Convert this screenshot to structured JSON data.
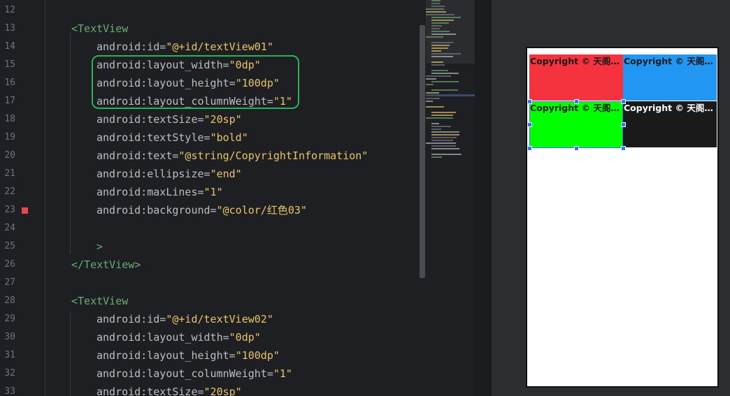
{
  "editor": {
    "line_numbers": [
      "12",
      "13",
      "14",
      "15",
      "16",
      "17",
      "18",
      "19",
      "20",
      "21",
      "22",
      "23",
      "24",
      "25",
      "26",
      "27",
      "28",
      "29",
      "30",
      "31",
      "32",
      "33"
    ],
    "lines": [
      {
        "indent": 0,
        "parts": []
      },
      {
        "indent": 1,
        "parts": [
          {
            "t": "tag",
            "v": "<TextView"
          }
        ]
      },
      {
        "indent": 2,
        "parts": [
          {
            "t": "attr",
            "v": "android:id="
          },
          {
            "t": "val",
            "v": "\"@+id/textView01\""
          }
        ]
      },
      {
        "indent": 2,
        "parts": [
          {
            "t": "attr",
            "v": "android:layout_width="
          },
          {
            "t": "val",
            "v": "\"0dp\""
          }
        ]
      },
      {
        "indent": 2,
        "parts": [
          {
            "t": "attr",
            "v": "android:layout_height="
          },
          {
            "t": "val",
            "v": "\"100dp\""
          }
        ]
      },
      {
        "indent": 2,
        "parts": [
          {
            "t": "attr",
            "v": "android:layout_columnWeight="
          },
          {
            "t": "val",
            "v": "\"1\""
          }
        ]
      },
      {
        "indent": 2,
        "parts": [
          {
            "t": "attr",
            "v": "android:textSize="
          },
          {
            "t": "val",
            "v": "\"20sp\""
          }
        ]
      },
      {
        "indent": 2,
        "parts": [
          {
            "t": "attr",
            "v": "android:textStyle="
          },
          {
            "t": "val",
            "v": "\"bold\""
          }
        ]
      },
      {
        "indent": 2,
        "parts": [
          {
            "t": "attr",
            "v": "android:text="
          },
          {
            "t": "val",
            "v": "\"@string/CopyrightInformation\""
          }
        ]
      },
      {
        "indent": 2,
        "parts": [
          {
            "t": "attr",
            "v": "android:ellipsize="
          },
          {
            "t": "val",
            "v": "\"end\""
          }
        ]
      },
      {
        "indent": 2,
        "parts": [
          {
            "t": "attr",
            "v": "android:maxLines="
          },
          {
            "t": "val",
            "v": "\"1\""
          }
        ]
      },
      {
        "indent": 2,
        "parts": [
          {
            "t": "attr",
            "v": "android:background="
          },
          {
            "t": "val",
            "v": "\"@color/红色03\""
          }
        ]
      },
      {
        "indent": 0,
        "parts": []
      },
      {
        "indent": 2,
        "parts": [
          {
            "t": "tag",
            "v": ">"
          }
        ]
      },
      {
        "indent": 1,
        "parts": [
          {
            "t": "tag",
            "v": "</TextView>"
          }
        ]
      },
      {
        "indent": 0,
        "parts": []
      },
      {
        "indent": 1,
        "parts": [
          {
            "t": "tag",
            "v": "<TextView"
          }
        ]
      },
      {
        "indent": 2,
        "parts": [
          {
            "t": "attr",
            "v": "android:id="
          },
          {
            "t": "val",
            "v": "\"@+id/textView02\""
          }
        ]
      },
      {
        "indent": 2,
        "parts": [
          {
            "t": "attr",
            "v": "android:layout_width="
          },
          {
            "t": "val",
            "v": "\"0dp\""
          }
        ]
      },
      {
        "indent": 2,
        "parts": [
          {
            "t": "attr",
            "v": "android:layout_height="
          },
          {
            "t": "val",
            "v": "\"100dp\""
          }
        ]
      },
      {
        "indent": 2,
        "parts": [
          {
            "t": "attr",
            "v": "android:layout_columnWeight="
          },
          {
            "t": "val",
            "v": "\"1\""
          }
        ]
      },
      {
        "indent": 2,
        "parts": [
          {
            "t": "attr",
            "v": "android:textSize="
          },
          {
            "t": "val",
            "v": "\"20sp\""
          }
        ]
      }
    ],
    "breakpoint_line": "23",
    "colors": {
      "tag": "#6aab73",
      "attr": "#bcbec4",
      "value": "#e8c46a",
      "highlight": "#2bb358"
    }
  },
  "preview": {
    "cells": [
      {
        "text": "Copyright © 天阁创意",
        "bg": "#f5333f",
        "fg": "#1a1a1a"
      },
      {
        "text": "Copyright © 天阁创意",
        "bg": "#2196f3",
        "fg": "#1a1a1a"
      },
      {
        "text": "Copyright © 天阁创意",
        "bg": "#00ff00",
        "fg": "#1a1a1a"
      },
      {
        "text": "Copyright © 天阁创意",
        "bg": "#1a1a1a",
        "fg": "#ffffff"
      }
    ]
  }
}
